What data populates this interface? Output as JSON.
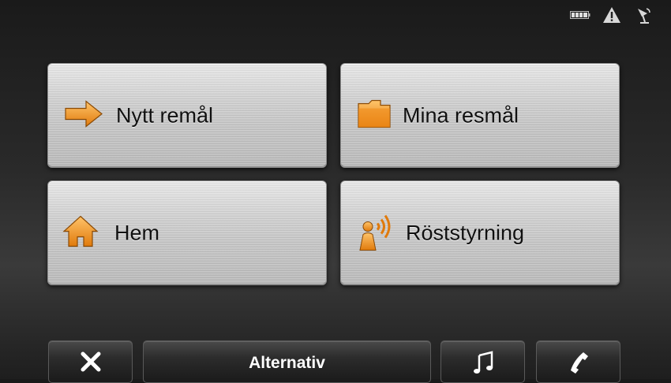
{
  "status_icons": [
    "battery-icon",
    "warning-icon",
    "gps-satellite-icon"
  ],
  "tiles": [
    {
      "label": "Nytt remål",
      "icon": "arrow-right-icon"
    },
    {
      "label": "Mina resmål",
      "icon": "folder-icon"
    },
    {
      "label": "Hem",
      "icon": "home-icon"
    },
    {
      "label": "Röststyrning",
      "icon": "voice-control-icon"
    }
  ],
  "bottom_bar": {
    "close_icon": "close-icon",
    "alternativ_label": "Alternativ",
    "music_icon": "music-note-icon",
    "phone_icon": "phone-icon"
  },
  "colors": {
    "accent": "#f39a1e",
    "tile": "#cfcfcf",
    "background": "#2a2a2a"
  }
}
